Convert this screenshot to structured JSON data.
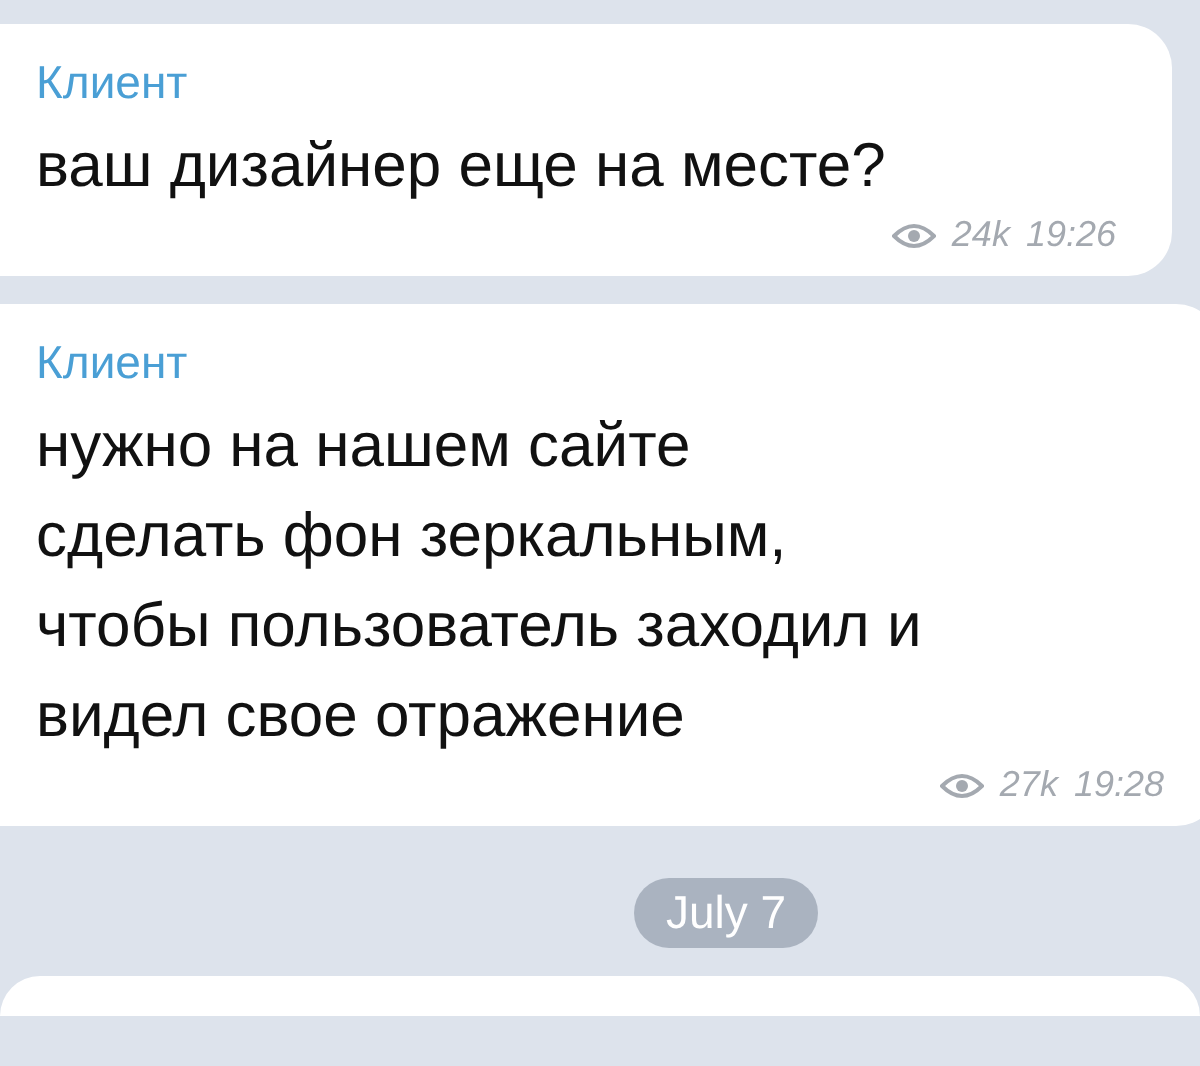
{
  "messages": [
    {
      "sender": "Клиент",
      "text": "ваш дизайнер еще на месте?",
      "views": "24k",
      "time": "19:26"
    },
    {
      "sender": "Клиент",
      "text": "нужно на нашем сайте\nсделать фон зеркальным,\nчтобы пользователь заходил и\nвидел свое отражение",
      "views": "27k",
      "time": "19:28"
    }
  ],
  "date_separator": "July 7"
}
